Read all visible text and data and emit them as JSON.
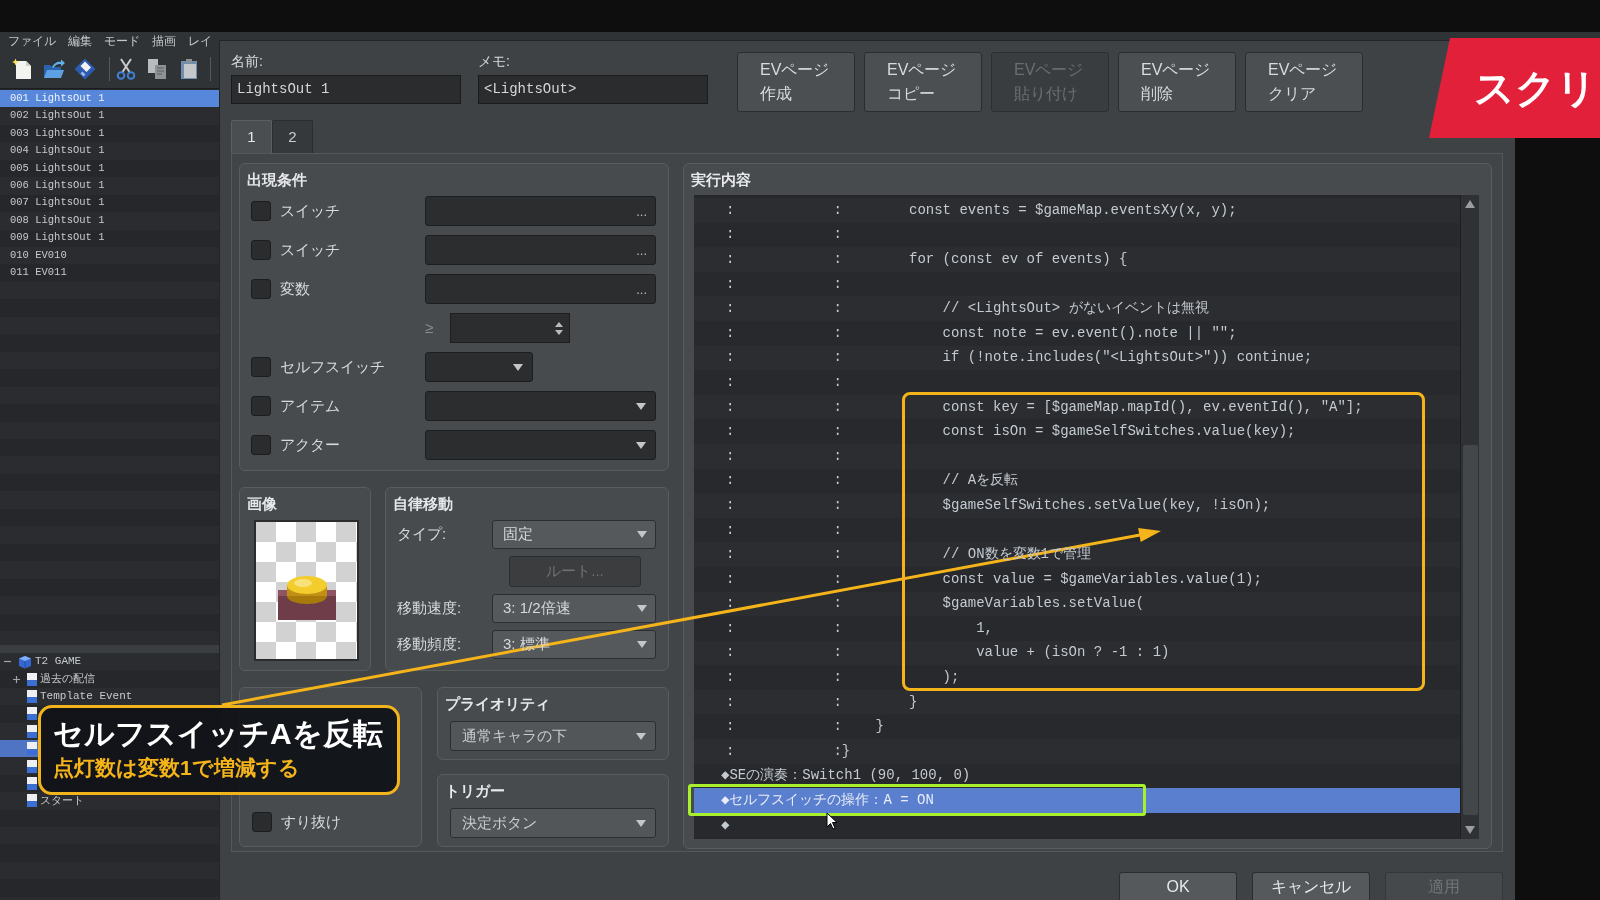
{
  "menu_bar": [
    "ファイル",
    "編集",
    "モード",
    "描画",
    "レイ"
  ],
  "event_list": [
    {
      "number": "001",
      "name": "LightsOut 1",
      "selected": true
    },
    {
      "number": "002",
      "name": "LightsOut 1",
      "selected": false
    },
    {
      "number": "003",
      "name": "LightsOut 1",
      "selected": false
    },
    {
      "number": "004",
      "name": "LightsOut 1",
      "selected": false
    },
    {
      "number": "005",
      "name": "LightsOut 1",
      "selected": false
    },
    {
      "number": "006",
      "name": "LightsOut 1",
      "selected": false
    },
    {
      "number": "007",
      "name": "LightsOut 1",
      "selected": false
    },
    {
      "number": "008",
      "name": "LightsOut 1",
      "selected": false
    },
    {
      "number": "009",
      "name": "LightsOut 1",
      "selected": false
    },
    {
      "number": "010",
      "name": "EV010",
      "selected": false
    },
    {
      "number": "011",
      "name": "EV011",
      "selected": false
    }
  ],
  "map_tree": [
    {
      "label": "T2 GAME",
      "expanded": true,
      "selected": false,
      "children": [
        {
          "label": "過去の配信",
          "expanded": false,
          "selected": false
        },
        {
          "label": "Template Event",
          "selected": false
        },
        {
          "selected": false
        },
        {
          "selected": false
        },
        {
          "selected": true
        },
        {
          "selected": false
        },
        {
          "selected": false
        },
        {
          "label": "スタート",
          "selected": false
        }
      ]
    }
  ],
  "event_dialog": {
    "name": {
      "label": "名前:",
      "value": "LightsOut 1"
    },
    "memo": {
      "label": "メモ:",
      "value": "<LightsOut>"
    },
    "page_buttons": [
      {
        "label": "EVページ作成",
        "disabled": false
      },
      {
        "label": "EVページコピー",
        "disabled": false
      },
      {
        "label": "EVページ貼り付け",
        "disabled": true
      },
      {
        "label": "EVページ削除",
        "disabled": false
      },
      {
        "label": "EVページクリア",
        "disabled": false
      }
    ],
    "tabs": [
      {
        "label": "1",
        "selected": true
      },
      {
        "label": "2",
        "selected": false
      }
    ],
    "conditions": {
      "title": "出現条件",
      "rows": [
        {
          "kind": "picker",
          "label": "スイッチ",
          "checked": false,
          "button": "..."
        },
        {
          "kind": "picker",
          "label": "スイッチ",
          "checked": false,
          "button": "..."
        },
        {
          "kind": "picker",
          "label": "変数",
          "checked": false,
          "button": "..."
        },
        {
          "kind": "spinner",
          "symbol": "≥"
        },
        {
          "kind": "combo",
          "label": "セルフスイッチ",
          "checked": false
        },
        {
          "kind": "dropdown",
          "label": "アイテム",
          "checked": false
        },
        {
          "kind": "dropdown",
          "label": "アクター",
          "checked": false
        }
      ]
    },
    "image": {
      "title": "画像"
    },
    "autonomous_movement": {
      "title": "自律移動",
      "rows": [
        {
          "kind": "dropdown",
          "label": "タイプ:",
          "value": "固定"
        },
        {
          "kind": "button",
          "label": "ルート...",
          "disabled": true
        },
        {
          "kind": "dropdown",
          "label": "移動速度:",
          "value": "3: 1/2倍速"
        },
        {
          "kind": "dropdown",
          "label": "移動頻度:",
          "value": "3: 標準"
        }
      ]
    },
    "options": [
      {
        "label": "すり抜け",
        "checked": false
      }
    ],
    "priority": {
      "title": "プライオリティ",
      "value": "通常キャラの下"
    },
    "trigger": {
      "title": "トリガー",
      "value": "決定ボタン"
    },
    "contents": {
      "title": "実行内容",
      "rows": [
        {
          "kind": "script",
          "lead": ":",
          "sep": ":",
          "code": "        const events = $gameMap.eventsXy(x, y);",
          "selected": false
        },
        {
          "kind": "script",
          "lead": ":",
          "sep": ":",
          "selected": false
        },
        {
          "kind": "script",
          "lead": ":",
          "sep": ":",
          "code": "        for (const ev of events) {",
          "selected": false
        },
        {
          "kind": "script",
          "lead": ":",
          "sep": ":",
          "selected": false
        },
        {
          "kind": "script",
          "lead": ":",
          "sep": ":",
          "code": "            // <LightsOut> がないイベントは無視",
          "selected": false
        },
        {
          "kind": "script",
          "lead": ":",
          "sep": ":",
          "code": "            const note = ev.event().note || \"\";",
          "selected": false
        },
        {
          "kind": "script",
          "lead": ":",
          "sep": ":",
          "code": "            if (!note.includes(\"<LightsOut>\")) continue;",
          "selected": false
        },
        {
          "kind": "script",
          "lead": ":",
          "sep": ":",
          "selected": false
        },
        {
          "kind": "script",
          "lead": ":",
          "sep": ":",
          "code": "            const key = [$gameMap.mapId(), ev.eventId(), \"A\"];",
          "selected": false
        },
        {
          "kind": "script",
          "lead": ":",
          "sep": ":",
          "code": "            const isOn = $gameSelfSwitches.value(key);",
          "selected": false
        },
        {
          "kind": "script",
          "lead": ":",
          "sep": ":",
          "selected": false
        },
        {
          "kind": "script",
          "lead": ":",
          "sep": ":",
          "code": "            // Aを反転",
          "selected": false
        },
        {
          "kind": "script",
          "lead": ":",
          "sep": ":",
          "code": "            $gameSelfSwitches.setValue(key, !isOn);",
          "selected": false
        },
        {
          "kind": "script",
          "lead": ":",
          "sep": ":",
          "selected": false
        },
        {
          "kind": "script",
          "lead": ":",
          "sep": ":",
          "code": "            // ON数を変数1で管理",
          "selected": false
        },
        {
          "kind": "script",
          "lead": ":",
          "sep": ":",
          "code": "            const value = $gameVariables.value(1);",
          "selected": false
        },
        {
          "kind": "script",
          "lead": ":",
          "sep": ":",
          "code": "            $gameVariables.setValue(",
          "selected": false
        },
        {
          "kind": "script",
          "lead": ":",
          "sep": ":",
          "code": "                1,",
          "selected": false
        },
        {
          "kind": "script",
          "lead": ":",
          "sep": ":",
          "code": "                value + (isOn ? -1 : 1)",
          "selected": false
        },
        {
          "kind": "script",
          "lead": ":",
          "sep": ":",
          "code": "            );",
          "selected": false
        },
        {
          "kind": "script",
          "lead": ":",
          "sep": ":",
          "code": "        }",
          "selected": false
        },
        {
          "kind": "script",
          "lead": ":",
          "sep": ":",
          "code": "    }",
          "selected": false
        },
        {
          "kind": "script",
          "lead": ":",
          "sep": ":",
          "code": "}",
          "selected": false
        },
        {
          "kind": "command",
          "text": "◆SEの演奏：Switch1 (90, 100, 0)",
          "selected": false
        },
        {
          "kind": "command",
          "text": "◆セルフスイッチの操作：A = ON",
          "selected": true
        },
        {
          "kind": "command",
          "text": "◆",
          "selected": false
        }
      ]
    },
    "buttons": [
      {
        "label": "OK",
        "disabled": false
      },
      {
        "label": "キャンセル",
        "disabled": false
      },
      {
        "label": "適用",
        "disabled": true
      }
    ]
  },
  "callout": {
    "title": "セルフスイッチAを反転",
    "subtitle": "点灯数は変数1で増減する"
  },
  "banner": {
    "text": "スクリ"
  }
}
